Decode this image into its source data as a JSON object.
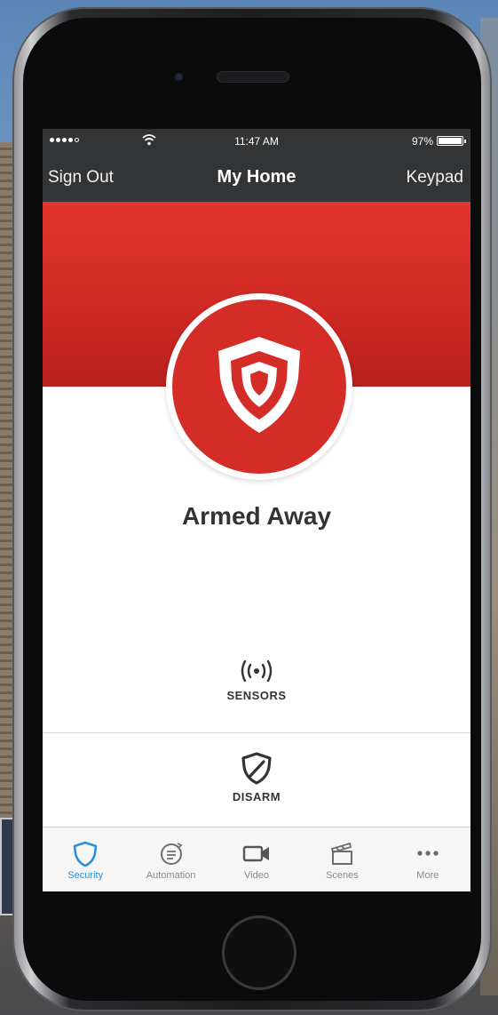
{
  "status_bar": {
    "time": "11:47 AM",
    "battery": "97%",
    "signal_icon": "signal-dots-icon",
    "wifi_icon": "wifi-icon"
  },
  "nav": {
    "left": "Sign Out",
    "title": "My Home",
    "right": "Keypad"
  },
  "security": {
    "status": "Armed Away",
    "status_icon": "shield-icon",
    "accent_color": "#d42d27"
  },
  "actions": [
    {
      "label": "SENSORS",
      "icon": "sensor-signal-icon"
    },
    {
      "label": "DISARM",
      "icon": "shield-slash-icon"
    }
  ],
  "tabs": [
    {
      "label": "Security",
      "icon": "shield-icon",
      "active": true
    },
    {
      "label": "Automation",
      "icon": "automation-icon",
      "active": false
    },
    {
      "label": "Video",
      "icon": "video-camera-icon",
      "active": false
    },
    {
      "label": "Scenes",
      "icon": "clapperboard-icon",
      "active": false
    },
    {
      "label": "More",
      "icon": "more-dots-icon",
      "active": false
    }
  ],
  "colors": {
    "active_tab": "#2d8fd5",
    "header_bg": "#333436"
  }
}
